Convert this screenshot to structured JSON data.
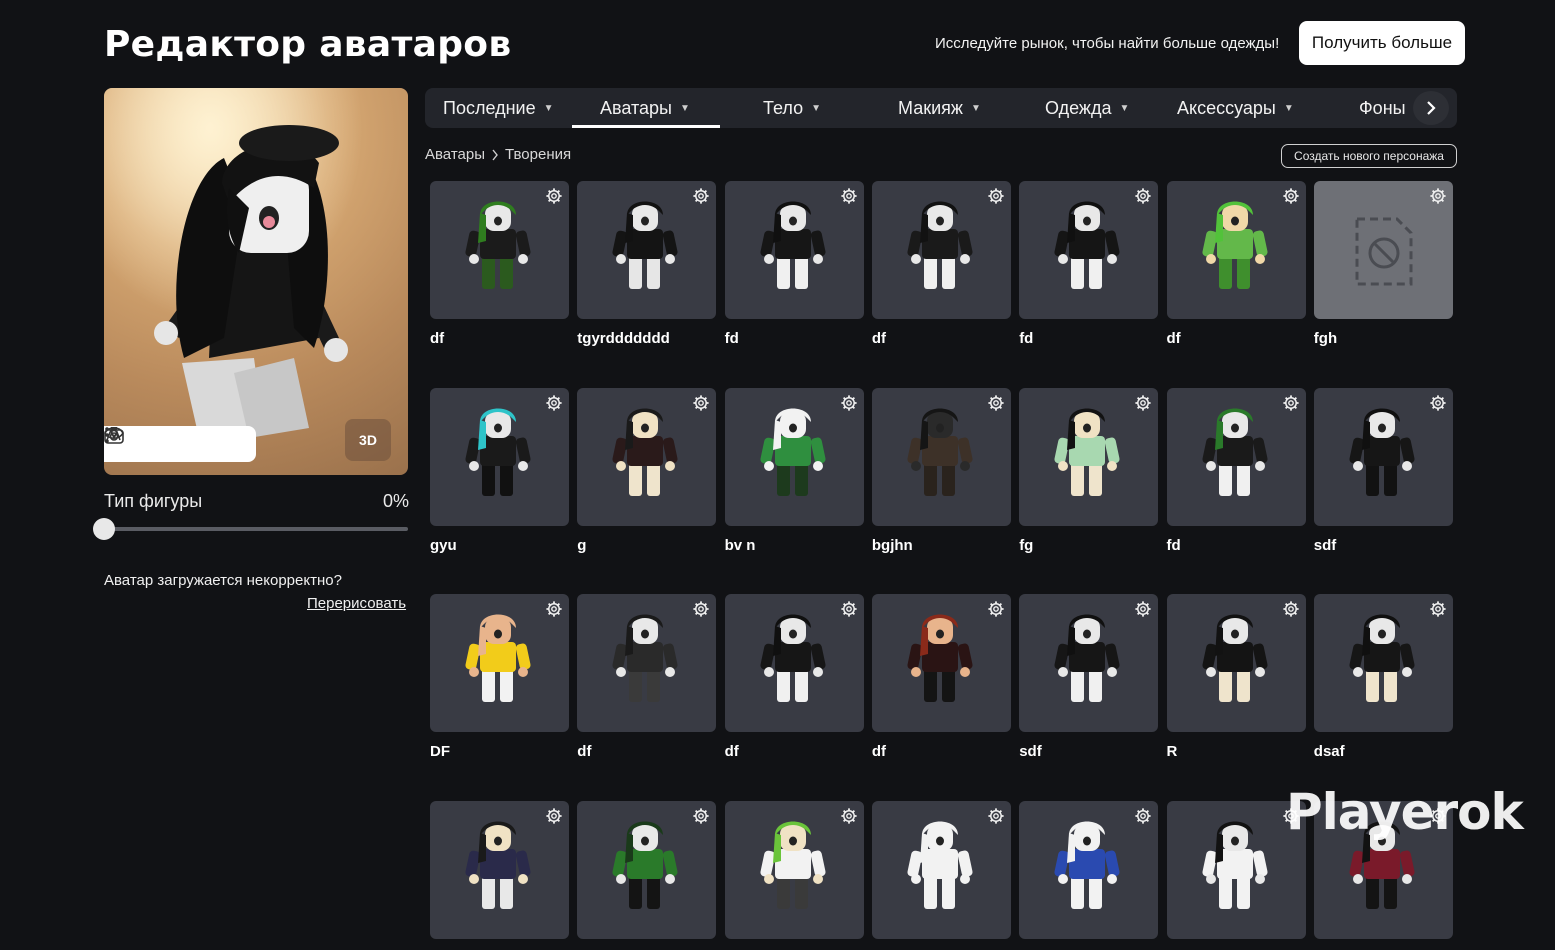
{
  "header": {
    "title": "Редактор аватаров",
    "promo_text": "Исследуйте рынок, чтобы найти больше одежды!",
    "get_more_label": "Получить больше"
  },
  "preview": {
    "btn_3d": "3D",
    "toolbar_icons": [
      "emote-icon",
      "eye-icon",
      "camera-icon",
      "more-icon"
    ]
  },
  "body_type": {
    "label": "Тип фигуры",
    "value": "0%",
    "fraction": 0
  },
  "broken_avatar": {
    "question": "Аватар загружается некорректно?",
    "redraw_label": "Перерисовать"
  },
  "tabs": [
    {
      "label": "Последние",
      "active": false
    },
    {
      "label": "Аватары",
      "active": true
    },
    {
      "label": "Тело",
      "active": false
    },
    {
      "label": "Макияж",
      "active": false
    },
    {
      "label": "Одежда",
      "active": false
    },
    {
      "label": "Аксессуары",
      "active": false
    },
    {
      "label": "Фоны",
      "active": false
    }
  ],
  "breadcrumb": {
    "root": "Аватары",
    "current": "Творения"
  },
  "new_character_label": "Создать нового персонажа",
  "outfits": [
    {
      "name": "df",
      "hair": "#2f7d1f",
      "shirt": "#1b1b1b",
      "pants": "#2b5a1e",
      "skin": "#e8e8e8"
    },
    {
      "name": "tgyrddddddd",
      "hair": "#121212",
      "shirt": "#141414",
      "pants": "#e6e6e6",
      "skin": "#e8e8e8"
    },
    {
      "name": "fd",
      "hair": "#101010",
      "shirt": "#161616",
      "pants": "#f0f0f0",
      "skin": "#e8e8e8"
    },
    {
      "name": "df",
      "hair": "#121212",
      "shirt": "#1a1a1a",
      "pants": "#f0f0f0",
      "skin": "#e8e8e8"
    },
    {
      "name": "fd",
      "hair": "#101010",
      "shirt": "#151515",
      "pants": "#f0f0f0",
      "skin": "#e8e8e8"
    },
    {
      "name": "df",
      "hair": "#52c23a",
      "shirt": "#63b84a",
      "pants": "#3f8f2d",
      "skin": "#f0d8a8"
    },
    {
      "name": "fgh",
      "empty": true
    },
    {
      "name": "gyu",
      "hair": "#2ec4c9",
      "shirt": "#1a1a1a",
      "pants": "#111111",
      "skin": "#e8e8e8"
    },
    {
      "name": "g",
      "hair": "#1a1a1a",
      "shirt": "#2a1a1a",
      "pants": "#efe4cc",
      "skin": "#f0e2c4"
    },
    {
      "name": "bv n",
      "hair": "#f2f2f2",
      "shirt": "#2f8f3f",
      "pants": "#1d3a1d",
      "skin": "#f2f2f2"
    },
    {
      "name": "bgjhn",
      "hair": "#151515",
      "shirt": "#3d3128",
      "pants": "#2a231d",
      "skin": "#2a2a2a"
    },
    {
      "name": "fg",
      "hair": "#121212",
      "shirt": "#a8d8b0",
      "pants": "#efe4cc",
      "skin": "#f0e2c4"
    },
    {
      "name": "fd",
      "hair": "#2a7a2a",
      "shirt": "#1a1a1a",
      "pants": "#f0f0f0",
      "skin": "#e8e8e8"
    },
    {
      "name": "sdf",
      "hair": "#101010",
      "shirt": "#161616",
      "pants": "#121212",
      "skin": "#e8e8e8"
    },
    {
      "name": "DF",
      "hair": "#e8b48c",
      "shirt": "#f2cc1a",
      "pants": "#f2f2f2",
      "skin": "#e8b48c"
    },
    {
      "name": "df",
      "hair": "#1a1a1a",
      "shirt": "#2a2a2a",
      "pants": "#3a3a3a",
      "skin": "#e8e8e8"
    },
    {
      "name": "df",
      "hair": "#101010",
      "shirt": "#161616",
      "pants": "#f0f0f0",
      "skin": "#e8e8e8"
    },
    {
      "name": "df",
      "hair": "#8a2a1a",
      "shirt": "#2a1414",
      "pants": "#141414",
      "skin": "#e8b48c"
    },
    {
      "name": "sdf",
      "hair": "#101010",
      "shirt": "#161616",
      "pants": "#f0f0f0",
      "skin": "#e8e8e8"
    },
    {
      "name": "R",
      "hair": "#121212",
      "shirt": "#141414",
      "pants": "#efe4cc",
      "skin": "#e8e8e8"
    },
    {
      "name": "dsaf",
      "hair": "#101010",
      "shirt": "#161616",
      "pants": "#efe4cc",
      "skin": "#e8e8e8"
    },
    {
      "name": "",
      "hair": "#1a1a1a",
      "shirt": "#2a2a4a",
      "pants": "#e8e8e8",
      "skin": "#f0e2c4"
    },
    {
      "name": "",
      "hair": "#1a3a1a",
      "shirt": "#2a7a2a",
      "pants": "#141414",
      "skin": "#e8e8e8"
    },
    {
      "name": "",
      "hair": "#6ac43a",
      "shirt": "#f2f2f2",
      "pants": "#3a3a3a",
      "skin": "#f0e2c4"
    },
    {
      "name": "",
      "hair": "#f2f2f2",
      "shirt": "#f2f2f2",
      "pants": "#f2f2f2",
      "skin": "#f2f2f2"
    },
    {
      "name": "",
      "hair": "#f2f2f2",
      "shirt": "#2a4ab0",
      "pants": "#f2f2f2",
      "skin": "#f2f2f2"
    },
    {
      "name": "",
      "hair": "#121212",
      "shirt": "#f2f2f2",
      "pants": "#f2f2f2",
      "skin": "#e8e8e8"
    },
    {
      "name": "",
      "hair": "#121212",
      "shirt": "#7a1a2a",
      "pants": "#141414",
      "skin": "#e8e8e8"
    }
  ],
  "watermark": "Playerok"
}
